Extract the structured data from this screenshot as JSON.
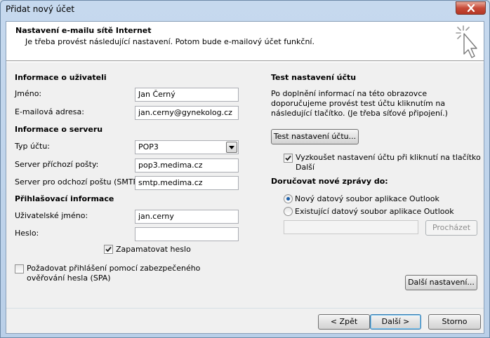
{
  "window": {
    "title": "Přidat nový účet"
  },
  "header": {
    "title": "Nastavení e-mailu sítě Internet",
    "subtitle": "Je třeba provést následující nastavení. Potom bude e-mailový účet funkční."
  },
  "user_info": {
    "heading": "Informace o uživateli",
    "name_label": "Jméno:",
    "name_value": "Jan Černý",
    "email_label": "E-mailová adresa:",
    "email_value": "jan.cerny@gynekolog.cz"
  },
  "server_info": {
    "heading": "Informace o serveru",
    "account_type_label": "Typ účtu:",
    "account_type_value": "POP3",
    "incoming_label": "Server příchozí pošty:",
    "incoming_value": "pop3.medima.cz",
    "outgoing_label": "Server pro odchozí poštu (SMTP):",
    "outgoing_value": "smtp.medima.cz"
  },
  "login_info": {
    "heading": "Přihlašovací informace",
    "username_label": "Uživatelské jméno:",
    "username_value": "jan.cerny",
    "password_label": "Heslo:",
    "password_value": "",
    "remember_label": "Zapamatovat heslo",
    "remember_checked": true,
    "spa_label": "Požadovat přihlášení pomocí zabezpečeného ověřování hesla (SPA)",
    "spa_checked": false
  },
  "test": {
    "heading": "Test nastavení účtu",
    "description": "Po doplnění informací na této obrazovce doporučujeme provést test účtu kliknutím na následující tlačítko. (Je třeba síťové připojení.)",
    "button_label": "Test nastavení účtu...",
    "auto_test_label": "Vyzkoušet nastavení účtu při kliknutí na tlačítko Další",
    "auto_test_checked": true
  },
  "delivery": {
    "heading": "Doručovat nové zprávy do:",
    "new_file_label": "Nový datový soubor aplikace Outlook",
    "existing_file_label": "Existující datový soubor aplikace Outlook",
    "selected": "new",
    "existing_path": "",
    "browse_label": "Procházet"
  },
  "more_settings_label": "Další nastavení...",
  "footer": {
    "back_label": "< Zpět",
    "next_label": "Další >",
    "cancel_label": "Storno"
  },
  "colors": {
    "window_frame": "#b9cfe8",
    "close_button": "#c74a38",
    "dialog_bg": "#f0f0f0",
    "header_bg": "#ffffff",
    "radio_dot": "#1b5ea8"
  }
}
